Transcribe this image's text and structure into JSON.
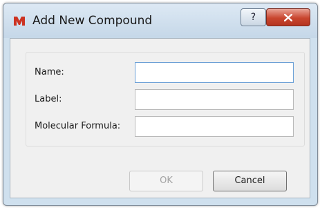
{
  "dialog": {
    "title": "Add New Compound",
    "help_glyph": "?",
    "fields": [
      {
        "label": "Name:",
        "value": "",
        "placeholder": ""
      },
      {
        "label": "Label:",
        "value": "",
        "placeholder": ""
      },
      {
        "label": "Molecular Formula:",
        "value": "",
        "placeholder": ""
      }
    ],
    "ok_label": "OK",
    "cancel_label": "Cancel"
  },
  "icons": {
    "app": "app-m-logo-icon",
    "help": "help-icon",
    "close": "close-icon"
  },
  "colors": {
    "logo": "#cc3322",
    "close_button": "#c9462f",
    "focus_border": "#6ba0d6"
  }
}
